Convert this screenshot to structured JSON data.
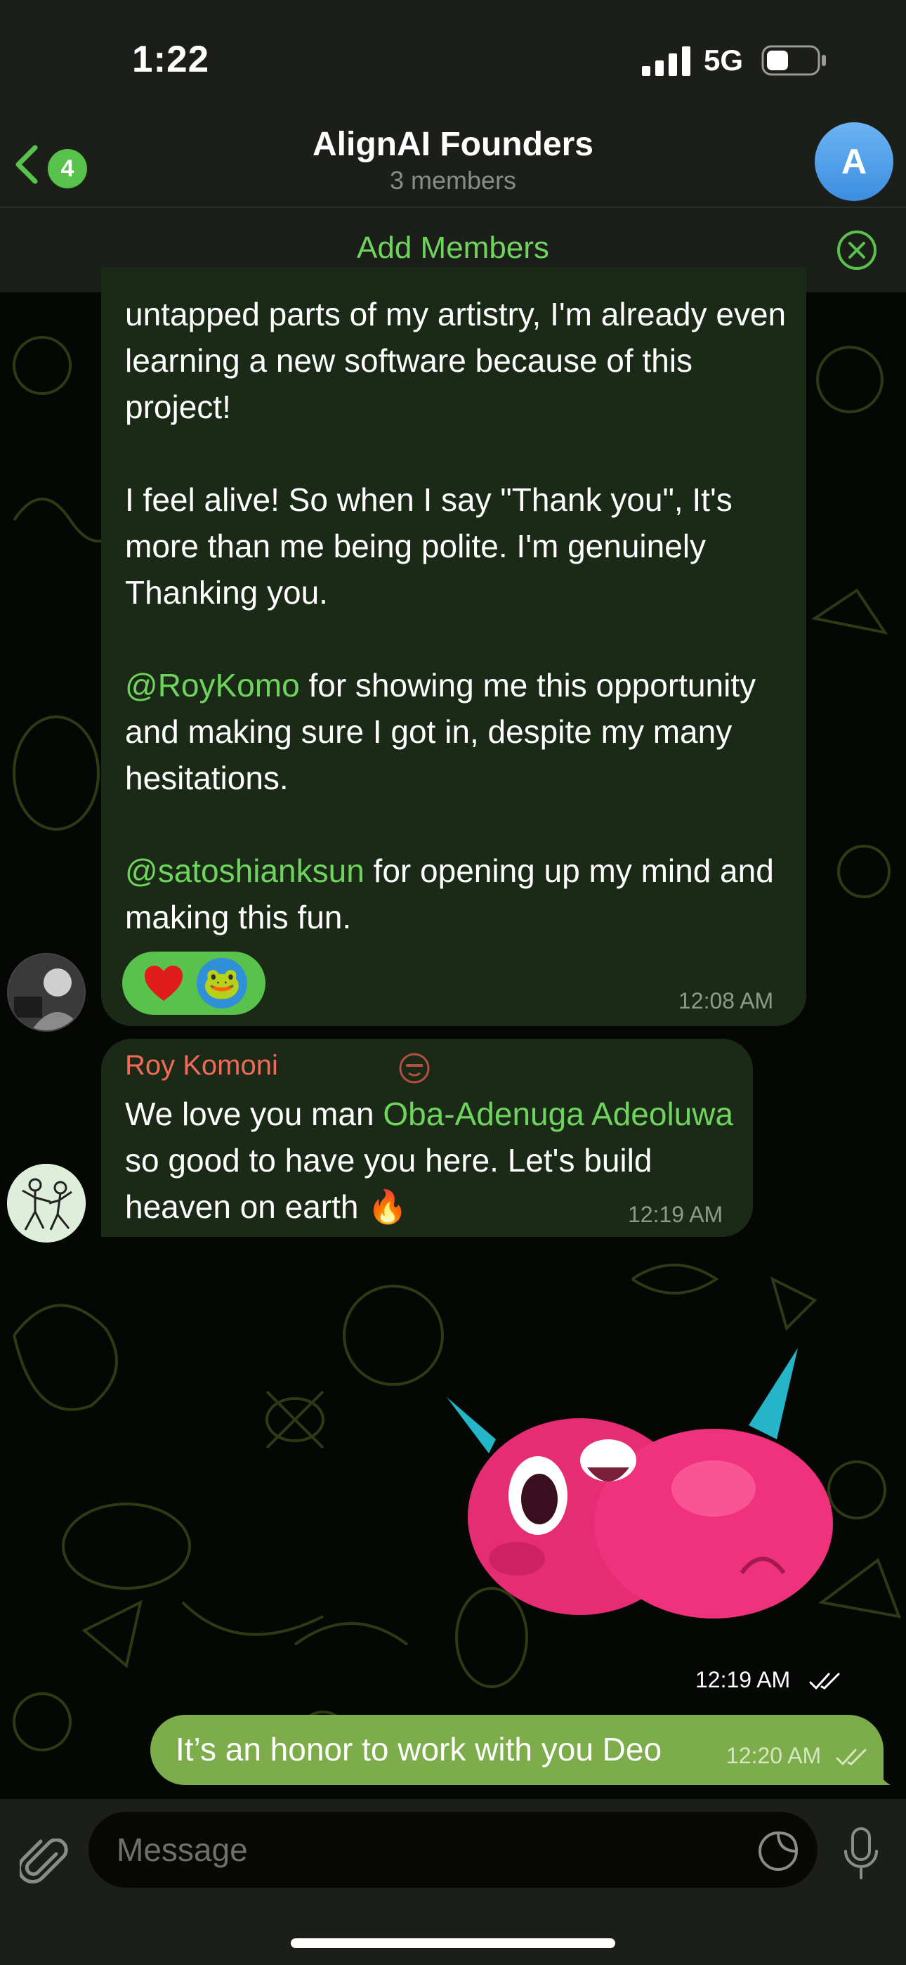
{
  "status_bar": {
    "time": "1:22",
    "network": "5G"
  },
  "header": {
    "back_count": "4",
    "title": "AlignAI Founders",
    "subtitle": "3 members",
    "avatar_letter": "A"
  },
  "add_members": {
    "label": "Add Members"
  },
  "messages": {
    "long_message": {
      "para1": "untapped parts of my artistry, I'm already even learning a new software because of this project!",
      "para2": "I feel alive! So when I say \"Thank you\", It's more than me being polite. I'm genuinely Thanking you.",
      "para3_mention": "@RoyKomo",
      "para3_text": " for showing me this opportunity and making sure I got in, despite my many hesitations.",
      "para4_mention": "@satoshianksun",
      "para4_text": " for opening up my mind and making this fun.",
      "time": "12:08 AM",
      "reactions": [
        "heart",
        "pepe"
      ]
    },
    "roy_message": {
      "sender": "Roy Komoni",
      "text_before": "We love you man ",
      "mention": "Oba-Adenuga Adeoluwa",
      "text_after": " so good to have you here. Let's build heaven on earth 🔥",
      "time": "12:19 AM"
    },
    "sticker": {
      "time": "12:19 AM"
    },
    "outgoing": {
      "text": "It’s an honor to work with you Deo",
      "time": "12:20 AM"
    }
  },
  "input": {
    "placeholder": "Message"
  },
  "colors": {
    "accent": "#59c24d",
    "outgoing_bubble": "#7dac4b",
    "incoming_bubble": "#1b2a17",
    "sender_name": "#f26a5a"
  }
}
